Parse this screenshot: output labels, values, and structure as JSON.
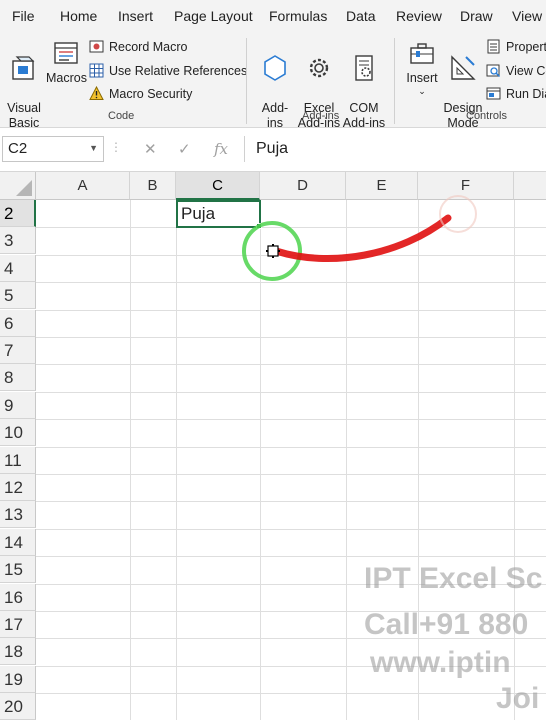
{
  "menu_tabs": [
    "File",
    "Home",
    "Insert",
    "Page Layout",
    "Formulas",
    "Data",
    "Review",
    "Draw",
    "View"
  ],
  "ribbon": {
    "code": {
      "visual_basic": "Visual\nBasic",
      "macros": "Macros",
      "record_macro": "Record Macro",
      "use_relative": "Use Relative References",
      "macro_security": "Macro Security",
      "label": "Code"
    },
    "addins": {
      "addins": "Add-\nins",
      "excel_addins": "Excel\nAdd-ins",
      "com_addins": "COM\nAdd-ins",
      "label": "Add-ins"
    },
    "controls": {
      "insert": "Insert",
      "design_mode": "Design\nMode",
      "properties": "Properti",
      "view_code": "View Co",
      "run_dialog": "Run Dia",
      "label": "Controls"
    }
  },
  "formula_bar": {
    "name_box": "C2",
    "cancel_glyph": "✕",
    "enter_glyph": "✓",
    "fx_glyph": "fx",
    "value": "Puja"
  },
  "grid": {
    "columns": [
      "A",
      "B",
      "C",
      "D",
      "E",
      "F"
    ],
    "selected_column": "C",
    "rows": [
      "2",
      "3",
      "4",
      "5",
      "6",
      "7",
      "8",
      "9",
      "10",
      "11",
      "12",
      "13",
      "14",
      "15",
      "16",
      "17",
      "18",
      "19",
      "20"
    ],
    "selected_row": "2",
    "active_cell_value": "Puja"
  },
  "watermark": {
    "line1": "IPT Excel Sc",
    "line2": "Call+91 880",
    "line3": "www.iptin",
    "line4": "Joi"
  },
  "colors": {
    "accent": "#217346",
    "annotation_arrow": "#e01010",
    "annotation_circle": "#4cd34c"
  }
}
